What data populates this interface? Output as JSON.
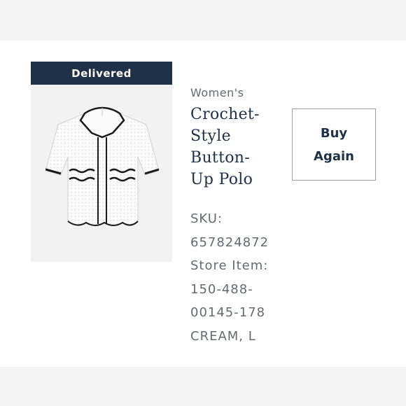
{
  "order_item": {
    "status_badge": "Delivered",
    "brand": "Women's",
    "name_lines": [
      "Crochet-",
      "Style",
      "Button-",
      "Up Polo"
    ],
    "sku_label": "SKU:",
    "sku_value": "657824872",
    "store_item_label": "Store Item:",
    "store_item_value_lines": [
      "150-488-",
      "00145-178"
    ],
    "variant": "CREAM, L",
    "buy_again_lines": [
      "Buy",
      "Again"
    ]
  },
  "colors": {
    "badge_bg": "#1e3147",
    "title_text": "#1e3147",
    "meta_text": "#666a70",
    "button_border": "#9aa0a6"
  },
  "icons": {
    "product_image": "crochet-polo-shirt"
  }
}
